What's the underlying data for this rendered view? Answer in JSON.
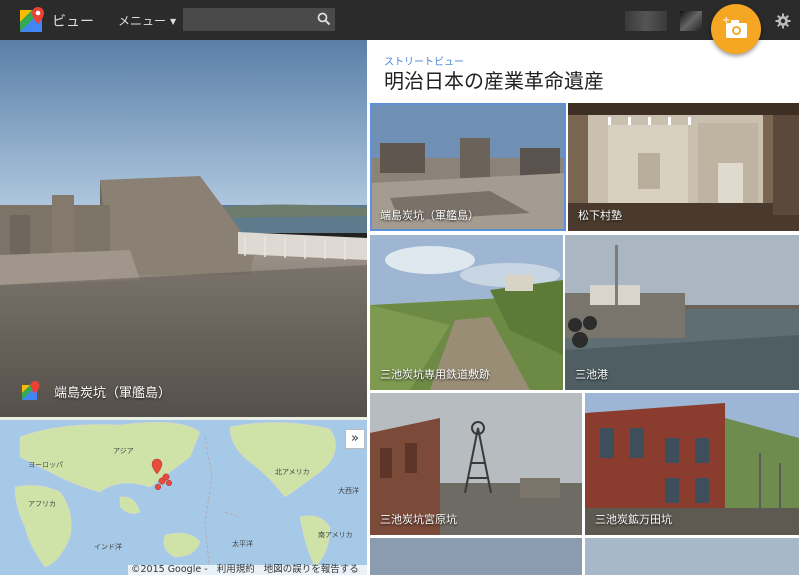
{
  "header": {
    "app_title": "ビュー",
    "menu_label": "メニュー",
    "search_placeholder": "",
    "logo_icon": "google-maps-logo-icon",
    "camera_icon": "add-photo-camera-icon",
    "settings_icon": "gear-icon",
    "accent_color": "#f5a623"
  },
  "streetview": {
    "place_name": "端島炭坑（軍艦島）"
  },
  "map": {
    "labels": [
      "アジア",
      "ヨーロッパ",
      "アフリカ",
      "インド洋",
      "北アメリカ",
      "大西洋",
      "太平洋",
      "南アメリカ"
    ],
    "footer": [
      "©2015 Google -",
      "利用規約",
      "地図の誤りを報告する"
    ]
  },
  "panel": {
    "subtitle": "ストリートビュー",
    "title": "明治日本の産業革命遺産",
    "tiles": [
      {
        "caption": "端島炭坑（軍艦島）",
        "selected": true
      },
      {
        "caption": "松下村塾",
        "selected": false
      },
      {
        "caption": "三池炭坑専用鉄道敷跡",
        "selected": false
      },
      {
        "caption": "三池港",
        "selected": false
      },
      {
        "caption": "三池炭坑宮原坑",
        "selected": false
      },
      {
        "caption": "三池炭鉱万田坑",
        "selected": false
      }
    ]
  }
}
